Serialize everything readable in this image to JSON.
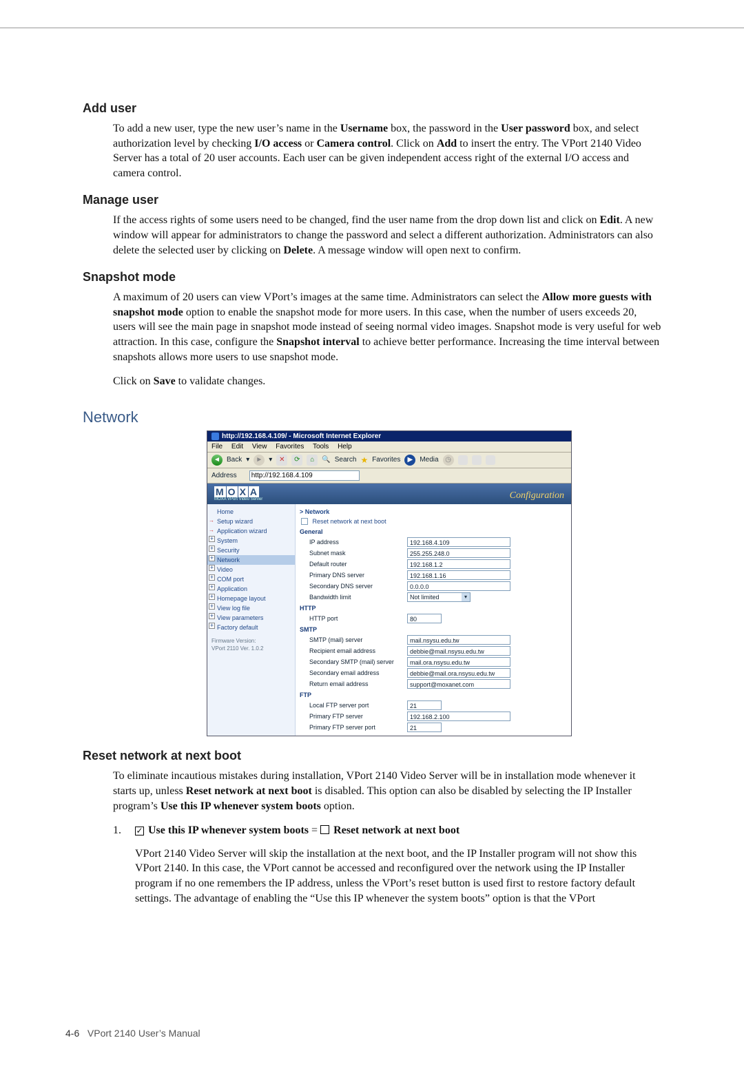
{
  "headings": {
    "add_user": "Add user",
    "manage_user": "Manage user",
    "snapshot_mode": "Snapshot mode",
    "network": "Network",
    "reset_net": "Reset network at next boot"
  },
  "paras": {
    "add_user": "To add a new user, type the new user’s name in the Username box, the password in the User password box, and select authorization level by checking I/O access or Camera control. Click on Add to insert the entry. The VPort 2140 Video Server has a total of 20 user accounts. Each user can be given independent access right of the external I/O access and camera control.",
    "manage_user": "If the access rights of some users need to be changed, find the user name from the drop down list and click on Edit. A new window will appear for administrators to change the password and select a different authorization. Administrators can also delete the selected user by clicking on Delete. A message window will open next to confirm.",
    "snapshot1": "A maximum of 20 users can view VPort’s images at the same time. Administrators can select the Allow more guests with snapshot mode option to enable the snapshot mode for more users. In this case, when the number of users exceeds 20, users will see the main page in snapshot mode instead of seeing normal video images. Snapshot mode is very useful for web attraction. In this case, configure the Snapshot interval to achieve better performance. Increasing the time interval between snapshots allows more users to use snapshot mode.",
    "snapshot2": "Click on Save to validate changes.",
    "reset1": "To eliminate incautious mistakes during installation, VPort 2140 Video Server will be in installation mode whenever it starts up, unless Reset network at next boot is disabled. This option can also be disabled by selecting the IP Installer program’s Use this IP whenever system boots option.",
    "reset_item_label": "Use this IP whenever system boots",
    "reset_item_eq": " = ",
    "reset_item_right": " Reset network at next boot",
    "reset_sub": "VPort 2140 Video Server will skip the installation at the next boot, and the IP Installer program will not show this VPort 2140. In this case, the VPort cannot be accessed and reconfigured over the network using the IP Installer program if no one remembers the IP address, unless the VPort’s reset button is used first to restore factory default settings. The advantage of enabling the “Use this IP whenever the system boots” option is that the VPort"
  },
  "ie": {
    "title": "http://192.168.4.109/ - Microsoft Internet Explorer",
    "menu": [
      "File",
      "Edit",
      "View",
      "Favorites",
      "Tools",
      "Help"
    ],
    "back": "Back",
    "search": "Search",
    "fav": "Favorites",
    "media": "Media",
    "addr_label": "Address",
    "addr_value": "http://192.168.4.109",
    "logo_sub": "MOXA VPort Video Server",
    "conf": "Configuration"
  },
  "sidebar": {
    "home": "Home",
    "setup": "Setup wizard",
    "app": "Application wizard",
    "system": "System",
    "security": "Security",
    "network": "Network",
    "video": "Video",
    "com": "COM port",
    "application": "Application",
    "layout": "Homepage layout",
    "log": "View log file",
    "params": "View parameters",
    "factory": "Factory default",
    "fw1": "Firmware Version:",
    "fw2": "VPort 2110 Ver. 1.0.2"
  },
  "cfg": {
    "crumb": "> Network",
    "reset_chk": "Reset network at next boot",
    "groups": {
      "general": "General",
      "http": "HTTP",
      "smtp": "SMTP",
      "ftp": "FTP"
    },
    "rows": {
      "ip": {
        "label": "IP address",
        "value": "192.168.4.109"
      },
      "mask": {
        "label": "Subnet mask",
        "value": "255.255.248.0"
      },
      "router": {
        "label": "Default router",
        "value": "192.168.1.2"
      },
      "dns1": {
        "label": "Primary DNS server",
        "value": "192.168.1.16"
      },
      "dns2": {
        "label": "Secondary DNS server",
        "value": "0.0.0.0"
      },
      "bw": {
        "label": "Bandwidth limit",
        "value": "Not limited"
      },
      "httpport": {
        "label": "HTTP port",
        "value": "80"
      },
      "smtp1": {
        "label": "SMTP (mail) server",
        "value": "mail.nsysu.edu.tw"
      },
      "remail": {
        "label": "Recipient email address",
        "value": "debbie@mail.nsysu.edu.tw"
      },
      "smtp2": {
        "label": "Secondary SMTP (mail) server",
        "value": "mail.ora.nsysu.edu.tw"
      },
      "semail": {
        "label": "Secondary email address",
        "value": "debbie@mail.ora.nsysu.edu.tw"
      },
      "retmail": {
        "label": "Return email address",
        "value": "support@moxanet.com"
      },
      "ftpport": {
        "label": "Local FTP server port",
        "value": "21"
      },
      "ftp1": {
        "label": "Primary FTP server",
        "value": "192.168.2.100"
      },
      "ftp1port": {
        "label": "Primary FTP server port",
        "value": "21"
      }
    }
  },
  "footer": {
    "page": "4-6",
    "title": "VPort 2140 User’s Manual"
  }
}
